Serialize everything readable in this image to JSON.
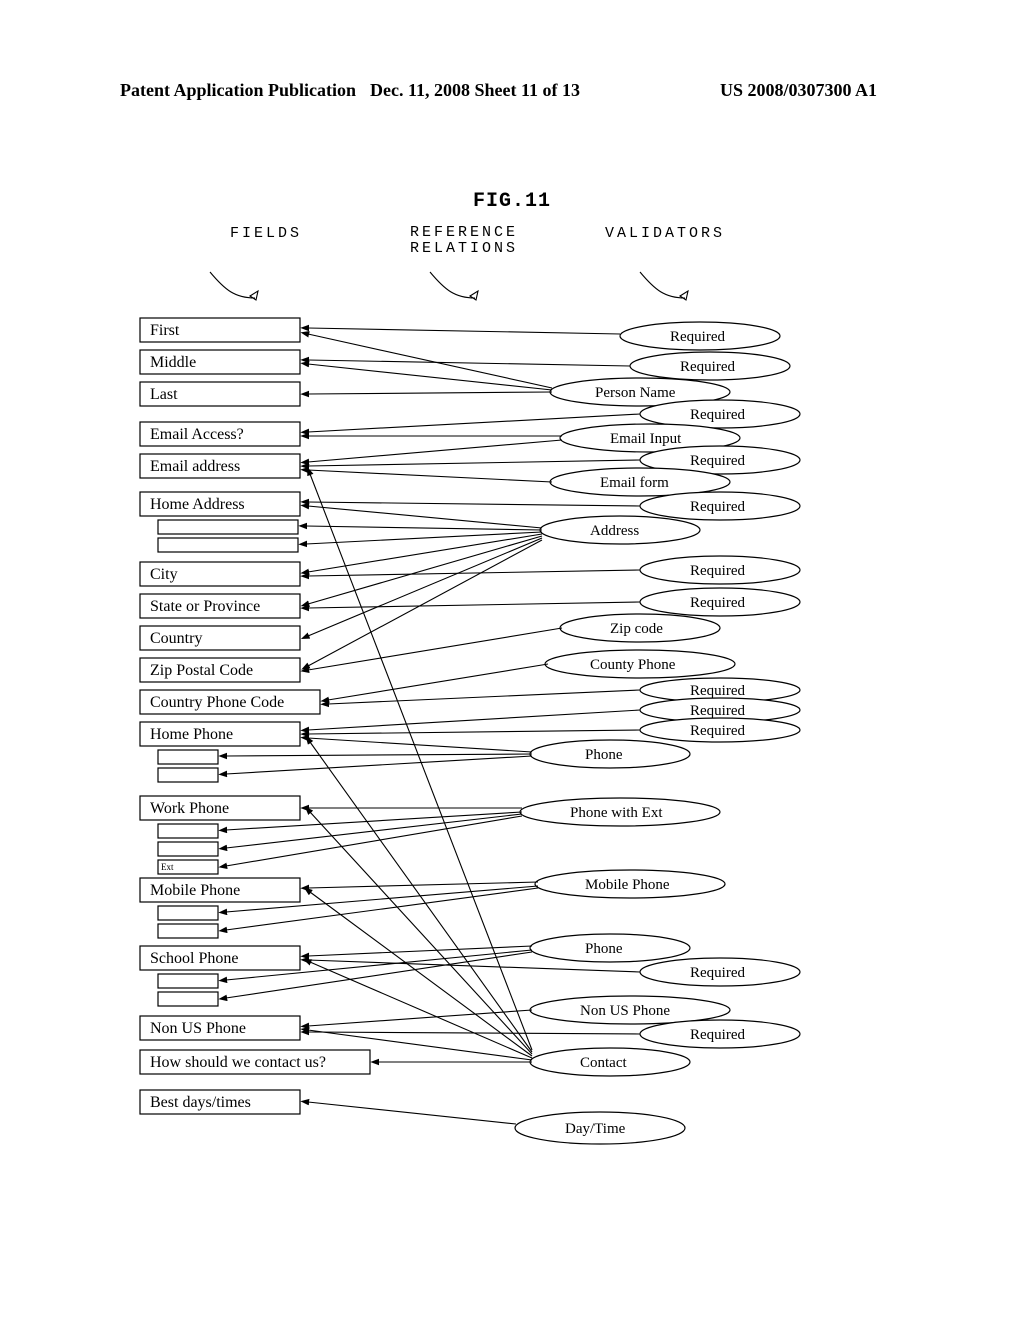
{
  "header": {
    "left": "Patent Application Publication",
    "mid": "Dec. 11, 2008  Sheet 11 of 13",
    "right": "US 2008/0307300 A1"
  },
  "figure_label": "FIG.11",
  "column_headers": {
    "fields": "FIELDS",
    "reference_relations_l1": "REFERENCE",
    "reference_relations_l2": "RELATIONS",
    "validators": "VALIDATORS"
  },
  "fields": {
    "first": "First",
    "middle": "Middle",
    "last": "Last",
    "email_access": "Email Access?",
    "email_address": "Email address",
    "home_address": "Home Address",
    "city": "City",
    "state_province": "State or Province",
    "country": "Country",
    "zip_postal": "Zip Postal Code",
    "country_phone_code": "Country Phone Code",
    "home_phone": "Home Phone",
    "work_phone": "Work Phone",
    "ext": "Ext",
    "mobile_phone": "Mobile Phone",
    "school_phone": "School Phone",
    "non_us_phone": "Non US Phone",
    "contact_q": "How should we contact us?",
    "best_days": "Best days/times"
  },
  "validators": {
    "required": "Required",
    "person_name": "Person Name",
    "email_input": "Email Input",
    "email_form": "Email form",
    "address": "Address",
    "zip_code": "Zip code",
    "county_phone": "County Phone",
    "phone": "Phone",
    "phone_with_ext": "Phone with Ext",
    "mobile_phone": "Mobile Phone",
    "non_us_phone": "Non US Phone",
    "contact": "Contact",
    "day_time": "Day/Time"
  },
  "chart_data": {
    "type": "diagram",
    "fields": [
      "First",
      "Middle",
      "Last",
      "Email Access?",
      "Email address",
      "Home Address",
      "City",
      "State or Province",
      "Country",
      "Zip Postal Code",
      "Country Phone Code",
      "Home Phone",
      "Work Phone",
      "Ext",
      "Mobile Phone",
      "School Phone",
      "Non US Phone",
      "How should we contact us?",
      "Best days/times"
    ],
    "validators": [
      "Required",
      "Person Name",
      "Email Input",
      "Email form",
      "Address",
      "Zip code",
      "County Phone",
      "Phone",
      "Phone with Ext",
      "Mobile Phone",
      "Non US Phone",
      "Contact",
      "Day/Time"
    ],
    "edges": [
      {
        "from": "Required",
        "to": "First"
      },
      {
        "from": "Required",
        "to": "Middle"
      },
      {
        "from": "Required",
        "to": "Last"
      },
      {
        "from": "Person Name",
        "to": "First"
      },
      {
        "from": "Person Name",
        "to": "Middle"
      },
      {
        "from": "Person Name",
        "to": "Last"
      },
      {
        "from": "Required",
        "to": "Email Access?"
      },
      {
        "from": "Email Input",
        "to": "Email Access?"
      },
      {
        "from": "Email Input",
        "to": "Email address"
      },
      {
        "from": "Required",
        "to": "Email address"
      },
      {
        "from": "Email form",
        "to": "Email address"
      },
      {
        "from": "Required",
        "to": "Home Address"
      },
      {
        "from": "Address",
        "to": "Home Address"
      },
      {
        "from": "Address",
        "to": "City"
      },
      {
        "from": "Address",
        "to": "State or Province"
      },
      {
        "from": "Address",
        "to": "Country"
      },
      {
        "from": "Address",
        "to": "Zip Postal Code"
      },
      {
        "from": "Required",
        "to": "City"
      },
      {
        "from": "Required",
        "to": "State or Province"
      },
      {
        "from": "Zip code",
        "to": "Zip Postal Code"
      },
      {
        "from": "County Phone",
        "to": "Country Phone Code"
      },
      {
        "from": "Required",
        "to": "Country Phone Code"
      },
      {
        "from": "Required",
        "to": "Home Phone"
      },
      {
        "from": "Phone",
        "to": "Home Phone"
      },
      {
        "from": "Phone with Ext",
        "to": "Work Phone"
      },
      {
        "from": "Mobile Phone",
        "to": "Mobile Phone"
      },
      {
        "from": "Phone",
        "to": "School Phone"
      },
      {
        "from": "Required",
        "to": "School Phone"
      },
      {
        "from": "Non US Phone",
        "to": "Non US Phone"
      },
      {
        "from": "Required",
        "to": "Non US Phone"
      },
      {
        "from": "Contact",
        "to": "How should we contact us?"
      },
      {
        "from": "Contact",
        "to": "Home Phone"
      },
      {
        "from": "Contact",
        "to": "Work Phone"
      },
      {
        "from": "Contact",
        "to": "Mobile Phone"
      },
      {
        "from": "Contact",
        "to": "School Phone"
      },
      {
        "from": "Contact",
        "to": "Non US Phone"
      },
      {
        "from": "Contact",
        "to": "Email address"
      },
      {
        "from": "Day/Time",
        "to": "Best days/times"
      }
    ]
  }
}
